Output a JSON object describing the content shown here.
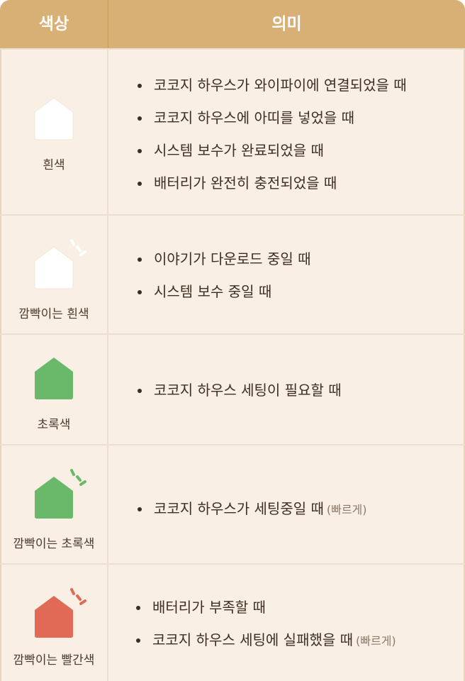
{
  "header": {
    "col_color": "색상",
    "col_meaning": "의미"
  },
  "colors": {
    "header_bg": "#d8b075",
    "table_bg": "#f9efe4",
    "white": "#ffffff",
    "green": "#6ab96a",
    "red": "#e06a55"
  },
  "rows": [
    {
      "label": "흰색",
      "house_color": "#ffffff",
      "blinking": false,
      "items": [
        {
          "text": "코코지 하우스가 와이파이에 연결되었을 때"
        },
        {
          "text": "코코지 하우스에 아띠를 넣었을 때"
        },
        {
          "text": "시스템 보수가 완료되었을 때"
        },
        {
          "text": "배터리가 완전히 충전되었을 때"
        }
      ]
    },
    {
      "label": "깜빡이는 흰색",
      "house_color": "#ffffff",
      "blinking": true,
      "items": [
        {
          "text": "이야기가 다운로드 중일 때"
        },
        {
          "text": "시스템 보수 중일 때"
        }
      ]
    },
    {
      "label": "초록색",
      "house_color": "#6ab96a",
      "blinking": false,
      "items": [
        {
          "text": "코코지 하우스 세팅이 필요할 때"
        }
      ]
    },
    {
      "label": "깜빡이는 초록색",
      "house_color": "#6ab96a",
      "blinking": true,
      "items": [
        {
          "text": "코코지 하우스가 세팅중일 때",
          "note": "(빠르게)"
        }
      ]
    },
    {
      "label": "깜빡이는 빨간색",
      "house_color": "#e06a55",
      "blinking": true,
      "items": [
        {
          "text": "배터리가 부족할 때"
        },
        {
          "text": "코코지 하우스 세팅에 실패했을 때",
          "note": "(빠르게)"
        }
      ]
    }
  ]
}
